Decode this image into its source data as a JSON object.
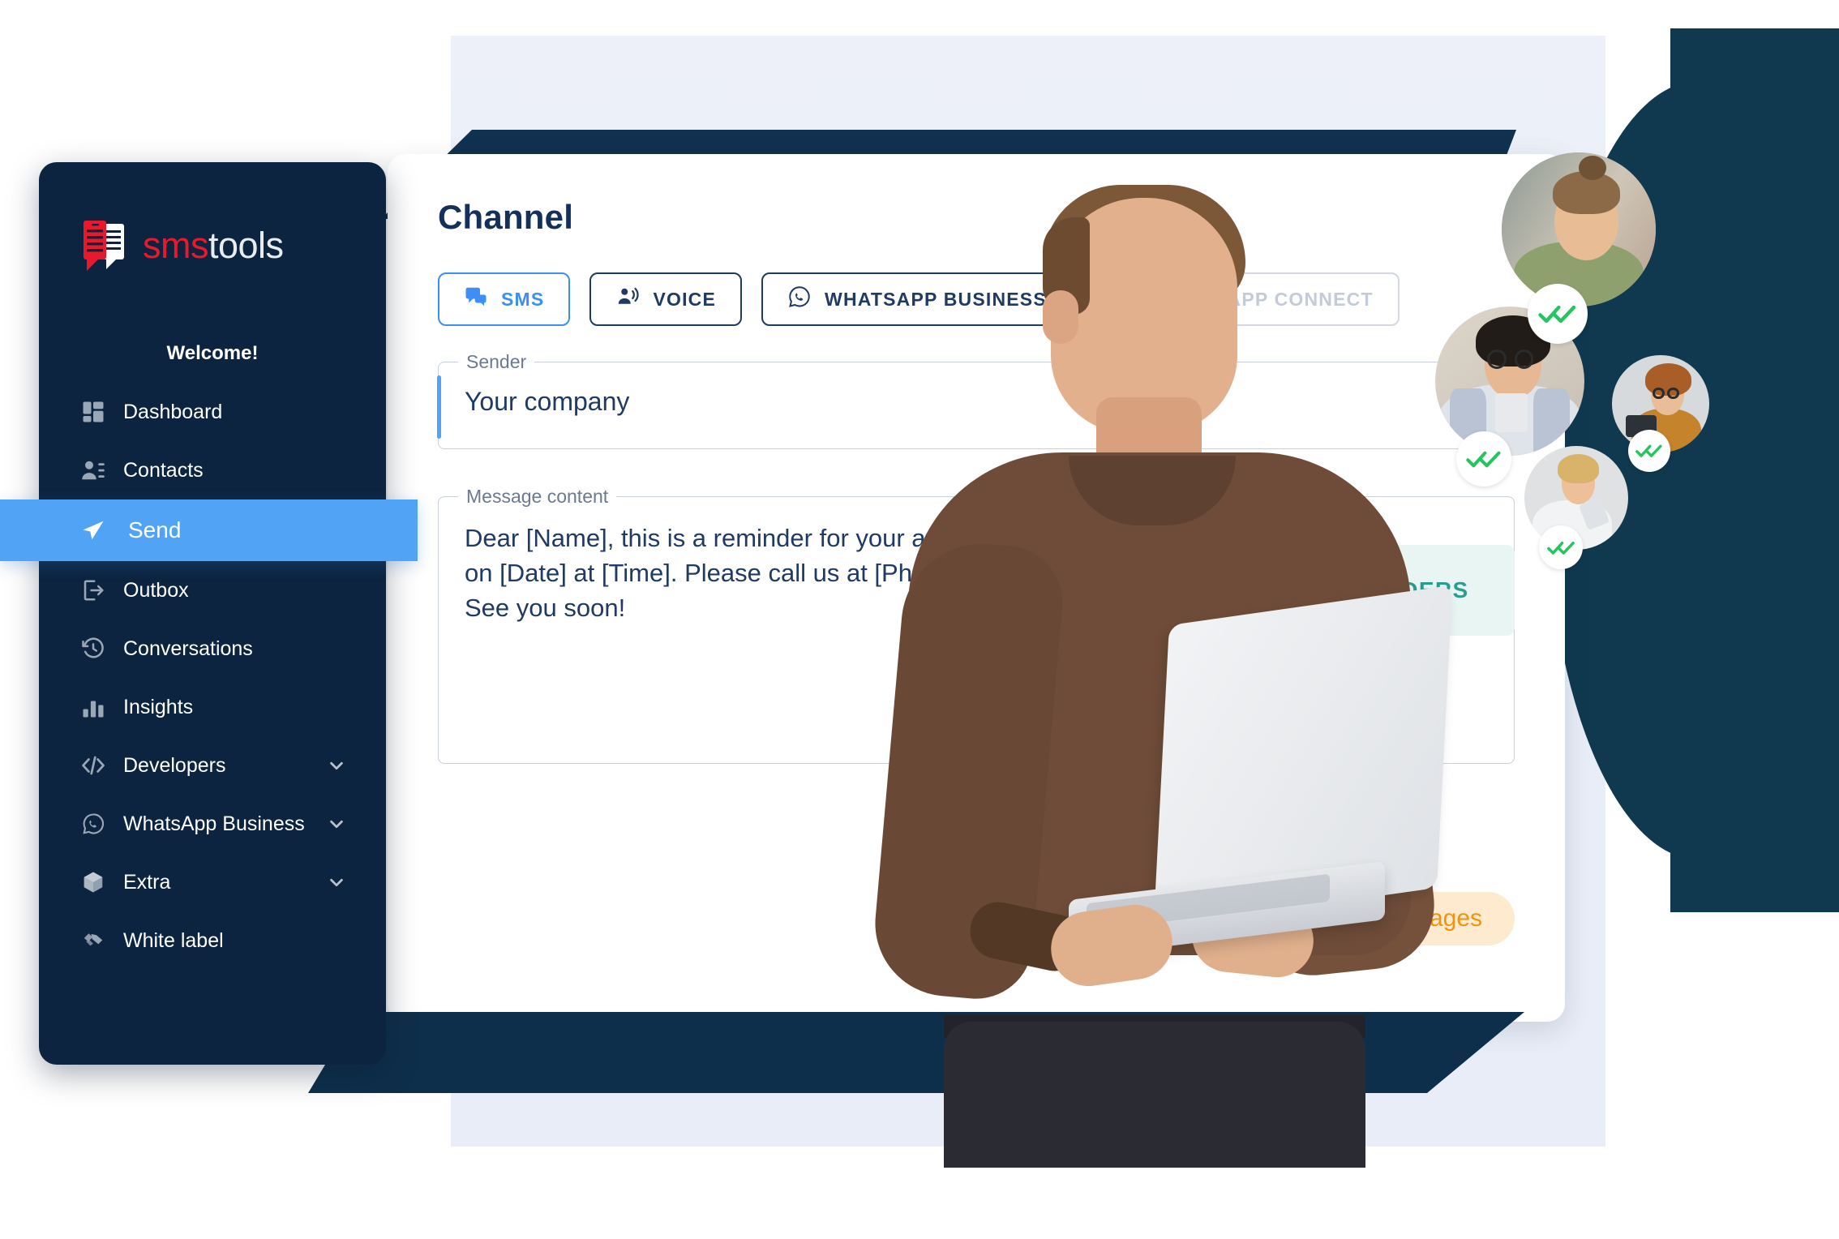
{
  "brand": {
    "logo_text_primary": "sms",
    "logo_text_secondary": "tools",
    "logo_icon": "chat-bubble-phone-icon",
    "color_red": "#e8192c",
    "color_navy": "#0d2440",
    "color_blue": "#51a4f5",
    "color_teal": "#2a9d8f",
    "color_orange": "#f2930d"
  },
  "sidebar": {
    "welcome": "Welcome!",
    "items": [
      {
        "label": "Dashboard",
        "icon": "grid-dashboard-icon",
        "active": false,
        "chevron": false
      },
      {
        "label": "Contacts",
        "icon": "contacts-person-icon",
        "active": false,
        "chevron": false
      },
      {
        "label": "Send",
        "icon": "paper-plane-icon",
        "active": true,
        "chevron": false
      },
      {
        "label": "Outbox",
        "icon": "outbox-arrow-icon",
        "active": false,
        "chevron": false
      },
      {
        "label": "Conversations",
        "icon": "clock-history-icon",
        "active": false,
        "chevron": false
      },
      {
        "label": "Insights",
        "icon": "bar-chart-icon",
        "active": false,
        "chevron": false
      },
      {
        "label": "Developers",
        "icon": "code-brackets-icon",
        "active": false,
        "chevron": true
      },
      {
        "label": "WhatsApp Business",
        "icon": "whatsapp-icon",
        "active": false,
        "chevron": true
      },
      {
        "label": "Extra",
        "icon": "cube-box-icon",
        "active": false,
        "chevron": true
      },
      {
        "label": "White label",
        "icon": "handshake-icon",
        "active": false,
        "chevron": false
      }
    ]
  },
  "main": {
    "title": "Channel",
    "tabs": [
      {
        "label": "SMS",
        "icon": "chat-bubble-icon",
        "state": "active"
      },
      {
        "label": "VOICE",
        "icon": "voice-speaker-icon",
        "state": "default"
      },
      {
        "label": "WHATSAPP BUSINESS",
        "icon": "whatsapp-icon",
        "state": "default"
      },
      {
        "label": "WHATSAPP CONNECT",
        "icon": "whatsapp-icon",
        "state": "muted"
      }
    ],
    "sender_field": {
      "legend": "Sender",
      "value": "Your company",
      "placeholder": "Your company"
    },
    "manage_senders_label": "MANAGE SENDERS",
    "message_field": {
      "legend": "Message content",
      "value": "Dear [Name], this is a reminder for your appointment at Barbershop on [Date] at [Time]. Please call us at [Phone] if needed. See you soon!",
      "lines": [
        "Dear [Name], this is a reminder for your appointment at Barbershop",
        "on [Date] at [Time]. Please call us at [Phone] if needed.",
        "See you soon!"
      ],
      "placeholder": "Message content"
    },
    "message_count_badge": "2 Messages"
  },
  "avatars": [
    {
      "name": "avatar-young-man-green-hoodie",
      "status_icon": "double-check-icon",
      "status": "delivered"
    },
    {
      "name": "avatar-person-glasses-striped-shirt",
      "status_icon": "double-check-icon",
      "status": "delivered"
    },
    {
      "name": "avatar-person-curly-hair-mustard",
      "status_icon": "double-check-icon",
      "status": "delivered"
    },
    {
      "name": "avatar-woman-white-tshirt",
      "status_icon": "double-check-icon",
      "status": "delivered"
    }
  ],
  "hero": {
    "person_description": "man-with-laptop-photo"
  }
}
